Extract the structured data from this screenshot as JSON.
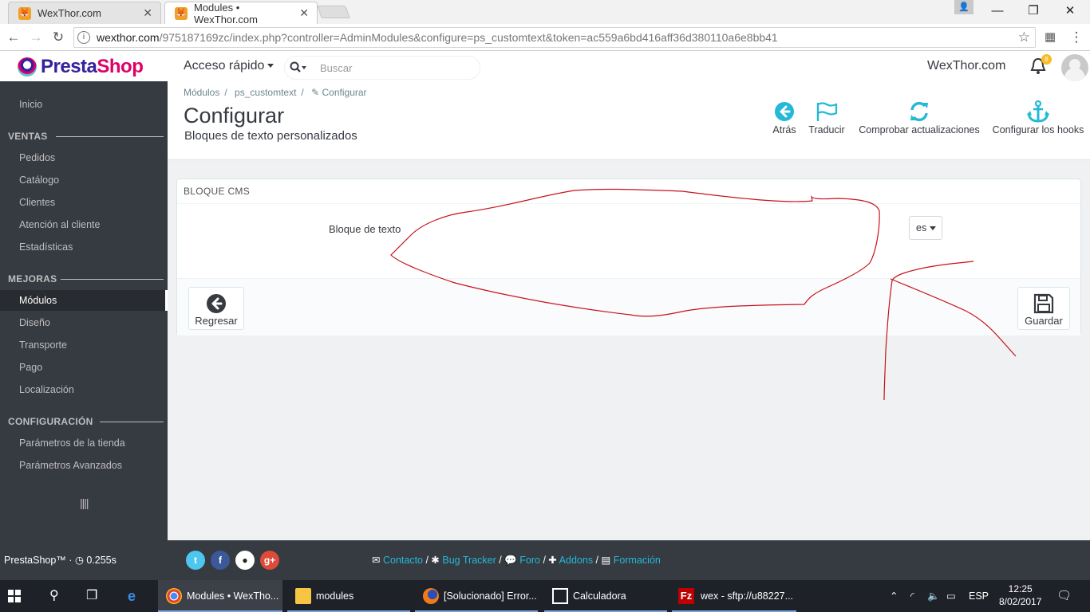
{
  "browser": {
    "tabs": [
      {
        "title": "WexThor.com",
        "active": false
      },
      {
        "title": "Modules • WexThor.com",
        "active": true
      }
    ],
    "url_host": "wexthor.com",
    "url_path": "/975187169zc/index.php?controller=AdminModules&configure=ps_customtext&token=ac559a6bd416aff36d380110a6e8bb41"
  },
  "header": {
    "logo_presta": "Presta",
    "logo_shop": "Shop",
    "quick_access": "Acceso rápido",
    "search_placeholder": "Buscar",
    "shop_name": "WexThor.com",
    "notifications_count": "8"
  },
  "sidebar": {
    "home": "Inicio",
    "sections": [
      {
        "title": "VENTAS",
        "items": [
          "Pedidos",
          "Catálogo",
          "Clientes",
          "Atención al cliente",
          "Estadísticas"
        ]
      },
      {
        "title": "MEJORAS",
        "items": [
          "Módulos",
          "Diseño",
          "Transporte",
          "Pago",
          "Localización"
        ]
      },
      {
        "title": "CONFIGURACIÓN",
        "items": [
          "Parámetros de la tienda",
          "Parámetros Avanzados"
        ]
      }
    ],
    "active_item": "Módulos"
  },
  "page": {
    "breadcrumb": [
      "Módulos",
      "ps_customtext",
      "Configurar"
    ],
    "title": "Configurar",
    "subtitle": "Bloques de texto personalizados",
    "toolbar": [
      "Atrás",
      "Traducir",
      "Comprobar actualizaciones",
      "Configurar los hooks"
    ]
  },
  "panel": {
    "heading": "BLOQUE CMS",
    "field_label": "Bloque de texto",
    "language": "es",
    "back_button": "Regresar",
    "save_button": "Guardar"
  },
  "footer": {
    "version": "PrestaShop™ · ",
    "load_time": "0.255s",
    "links": [
      "Contacto",
      "Bug Tracker",
      "Foro",
      "Addons",
      "Formación"
    ]
  },
  "taskbar": {
    "apps": [
      "Modules • WexTho...",
      "modules",
      "[Solucionado] Error...",
      "Calculadora",
      "wex - sftp://u88227..."
    ],
    "language": "ESP",
    "time": "12:25",
    "date": "8/02/2017"
  },
  "colors": {
    "accent": "#25b9d7",
    "sidebar": "#363a41",
    "annotation": "#c8101e"
  }
}
